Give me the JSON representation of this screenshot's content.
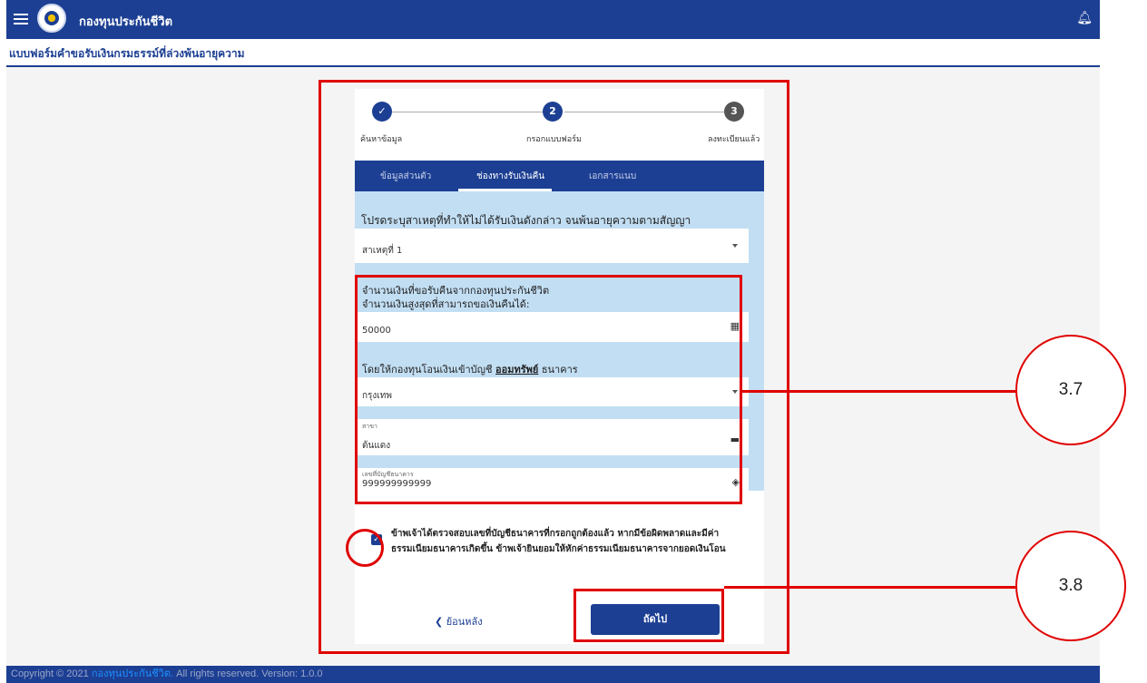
{
  "header": {
    "app_title": "กองทุนประกันชีวิต",
    "menu_icon": "hamburger-menu-icon",
    "logo_icon": "fund-logo-icon",
    "bell_icon": "bell-icon"
  },
  "subheader": {
    "title": "แบบฟอร์มคำขอรับเงินกรมธรรม์ที่ล่วงพ้นอายุความ"
  },
  "stepper": {
    "steps": [
      {
        "number": "✓",
        "label": "ค้นหาข้อมูล",
        "state": "done"
      },
      {
        "number": "2",
        "label": "กรอกแบบฟอร์ม",
        "state": "active"
      },
      {
        "number": "3",
        "label": "ลงทะเบียนแล้ว",
        "state": "pending"
      }
    ]
  },
  "tabs": [
    {
      "label": "ข้อมูลส่วนตัว"
    },
    {
      "label": "ช่องทางรับเงินคืน"
    },
    {
      "label": "เอกสารแนบ"
    }
  ],
  "form": {
    "question": "โปรดระบุสาเหตุที่ทำให้ไม่ได้รับเงินดังกล่าว จนพ้นอายุความตามสัญญา",
    "reason_value": "สาเหตุที่ 1",
    "refund_label": "จำนวนเงินที่ขอรับคืนจากกองทุนประกันชีวิต",
    "max_amount_label": "จำนวนเงินสูงสุดที่สามารถขอเงินคืนได้:",
    "amount_value": "50000",
    "transfer_prefix": "โดยให้กองทุนโอนเงินเข้าบัญชี",
    "transfer_type": "ออมทรัพย์",
    "transfer_suffix": "ธนาคาร",
    "bank_value": "กรุงเทพ",
    "branch_label": "สาขา",
    "branch_value": "ต้นแดง",
    "account_label": "เลขที่บัญชีธนาคาร",
    "account_value": "999999999999",
    "consent_text": "ข้าพเจ้าได้ตรวจสอบเลขที่บัญชีธนาคารที่กรอกถูกต้องแล้ว หากมีข้อผิดพลาดและมีค่าธรรมเนียมธนาคารเกิดขึ้น ข้าพเจ้ายินยอมให้หักค่าธรรมเนียมธนาคารจากยอดเงินโอน",
    "consent_checked": true,
    "back_label": "ย้อนหลัง",
    "next_label": "ถัดไป"
  },
  "annotations": {
    "callout_1": "3.7",
    "callout_2": "3.8",
    "accent_color": "#e00000"
  },
  "footer": {
    "copyright": "Copyright © 2021",
    "brand": "กองทุนประกันชีวิต.",
    "rights": "All rights reserved. Version: 1.0.0"
  },
  "colors": {
    "primary": "#1c3f93",
    "form_background": "#c2def3"
  }
}
